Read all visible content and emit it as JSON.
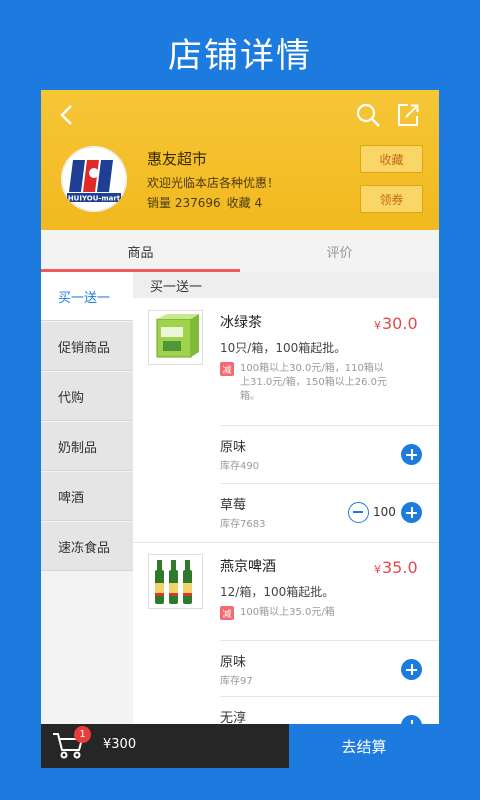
{
  "page_title": "店铺详情",
  "shop": {
    "name": "惠友超市",
    "welcome": "欢迎光临本店各种优惠！",
    "sales": "销量 237696",
    "favorites": "收藏 4",
    "fav_label": "收藏",
    "coupon_label": "领券",
    "logo_text": "HUIYOU-mart"
  },
  "tabs": [
    "商品",
    "评价"
  ],
  "sidebar": [
    "买一送一",
    "促销商品",
    "代购",
    "奶制品",
    "啤酒",
    "速冻食品"
  ],
  "section_title": "买一送一",
  "products": [
    {
      "name": "冰绿茶",
      "price_symbol": "¥",
      "price": "30.0",
      "spec": "10只/箱，100箱起批。",
      "discount_tag": "减",
      "discount_lines": [
        "100箱以上30.0元/箱，110箱以",
        "上31.0元/箱，150箱以上26.0元",
        "箱。"
      ],
      "variants": [
        {
          "name": "原味",
          "stock": "库存490"
        },
        {
          "name": "草莓",
          "stock": "库存7683",
          "qty": "100"
        }
      ]
    },
    {
      "name": "燕京啤酒",
      "price_symbol": "¥",
      "price": "35.0",
      "spec": "12/箱，100箱起批。",
      "discount_tag": "减",
      "discount_lines": [
        "100箱以上35.0元/箱"
      ],
      "variants": [
        {
          "name": "原味",
          "stock": "库存97"
        },
        {
          "name": "无淳"
        }
      ]
    }
  ],
  "cart": {
    "badge": "1",
    "total": "¥300",
    "checkout_label": "去结算"
  },
  "colors": {
    "header": "#f4be2a",
    "accent": "#1d7be0",
    "price": "#e8474a",
    "tab_indicator": "#f25a5a"
  }
}
